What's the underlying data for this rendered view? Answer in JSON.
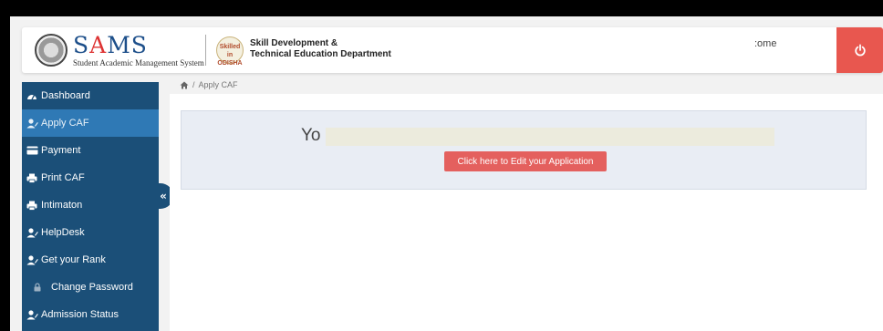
{
  "header": {
    "brand_main": "S",
    "brand_accent": "A",
    "brand_rest": "MS",
    "brand_subtitle": "Student Academic Management System",
    "dept_logo_text": "Skilled in ODISHA",
    "dept_line1": "Skill Development &",
    "dept_line2": "Technical Education Department",
    "welcome_text": ":ome",
    "power_icon": "power-icon"
  },
  "sidebar": {
    "items": [
      {
        "label": "Dashboard",
        "icon": "dashboard-icon",
        "active": false
      },
      {
        "label": "Apply CAF",
        "icon": "user-edit-icon",
        "active": true
      },
      {
        "label": "Payment",
        "icon": "credit-card-icon",
        "active": false
      },
      {
        "label": "Print CAF",
        "icon": "print-icon",
        "active": false
      },
      {
        "label": "Intimaton",
        "icon": "print-icon",
        "active": false
      },
      {
        "label": "HelpDesk",
        "icon": "user-edit-icon",
        "active": false
      },
      {
        "label": "Get your Rank",
        "icon": "user-edit-icon",
        "active": false
      },
      {
        "label": "Change Password",
        "icon": "lock-icon",
        "active": false
      },
      {
        "label": "Admission Status",
        "icon": "user-edit-icon",
        "active": false
      }
    ],
    "collapse_glyph": "«"
  },
  "breadcrumb": {
    "separator": "/",
    "current": "Apply CAF"
  },
  "main": {
    "heading": "Yo",
    "edit_button": "Click here to Edit your Application"
  },
  "colors": {
    "sidebar_bg": "#1b4f78",
    "sidebar_active": "#2f79b5",
    "accent_red": "#e4605e",
    "power_red": "#e8574f",
    "brand_blue": "#1d4f8a"
  }
}
